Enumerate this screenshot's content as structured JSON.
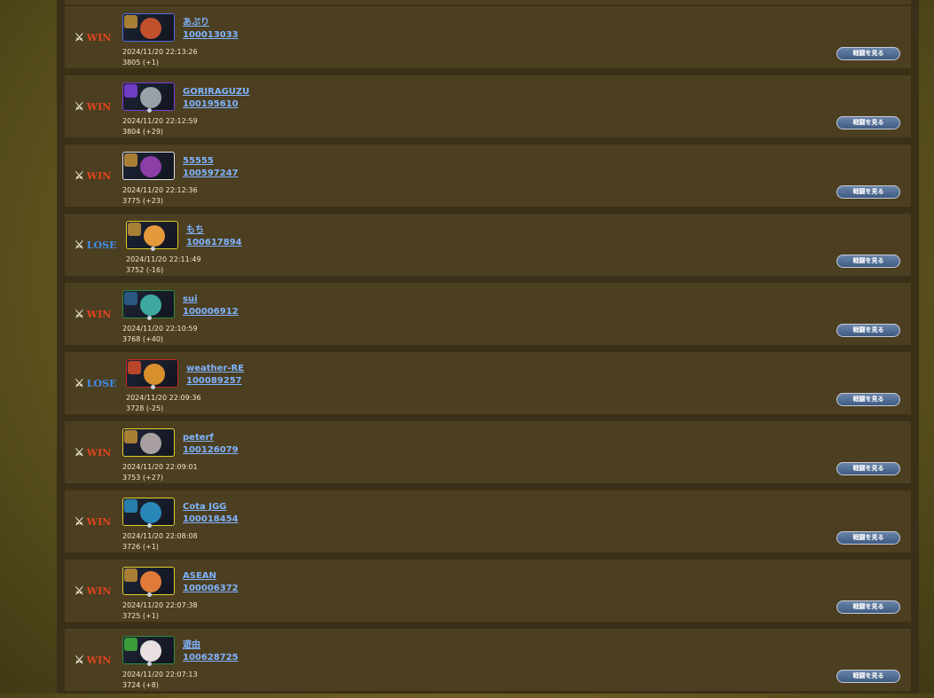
{
  "battle_button_label": "戦闘を見る",
  "colors": {
    "win": "#e0451f",
    "lose": "#3f8ef0",
    "link": "#7eb4ff",
    "panel": "#4c3e20"
  },
  "battles": [
    {
      "result": "WIN",
      "name": "あぷり",
      "id": "100013033",
      "time": "2024/11/20 22:13:26",
      "rating": "3805 (+1)",
      "frame": "blue",
      "avatar_color": "#c2502c"
    },
    {
      "result": "WIN",
      "name": "GORIRAGUZU",
      "id": "100195610",
      "time": "2024/11/20 22:12:59",
      "rating": "3804 (+29)",
      "frame": "purple",
      "avatar_color": "#9aa0a8"
    },
    {
      "result": "WIN",
      "name": "55555",
      "id": "100597247",
      "time": "2024/11/20 22:12:36",
      "rating": "3775 (+23)",
      "frame": "white",
      "avatar_color": "#8c3fa6"
    },
    {
      "result": "LOSE",
      "name": "もち",
      "id": "100617894",
      "time": "2024/11/20 22:11:49",
      "rating": "3752 (-16)",
      "frame": "yellow",
      "avatar_color": "#e49a3a"
    },
    {
      "result": "WIN",
      "name": "sui",
      "id": "100006912",
      "time": "2024/11/20 22:10:59",
      "rating": "3768 (+40)",
      "frame": "green",
      "avatar_color": "#3ea8a0"
    },
    {
      "result": "LOSE",
      "name": "weather-RE",
      "id": "100089257",
      "time": "2024/11/20 22:09:36",
      "rating": "3728 (-25)",
      "frame": "red",
      "avatar_color": "#d8902c"
    },
    {
      "result": "WIN",
      "name": "peterf",
      "id": "100126079",
      "time": "2024/11/20 22:09:01",
      "rating": "3753 (+27)",
      "frame": "yellow",
      "avatar_color": "#a8a0a0"
    },
    {
      "result": "WIN",
      "name": "Cota JGG",
      "id": "100018454",
      "time": "2024/11/20 22:08:08",
      "rating": "3726 (+1)",
      "frame": "yellow",
      "avatar_color": "#2a88b8"
    },
    {
      "result": "WIN",
      "name": "ASEAN",
      "id": "100006372",
      "time": "2024/11/20 22:07:38",
      "rating": "3725 (+1)",
      "frame": "yellow",
      "avatar_color": "#e07a3a"
    },
    {
      "result": "WIN",
      "name": "遊由",
      "id": "100628725",
      "time": "2024/11/20 22:07:13",
      "rating": "3724 (+8)",
      "frame": "green",
      "avatar_color": "#e8e0e0"
    }
  ]
}
